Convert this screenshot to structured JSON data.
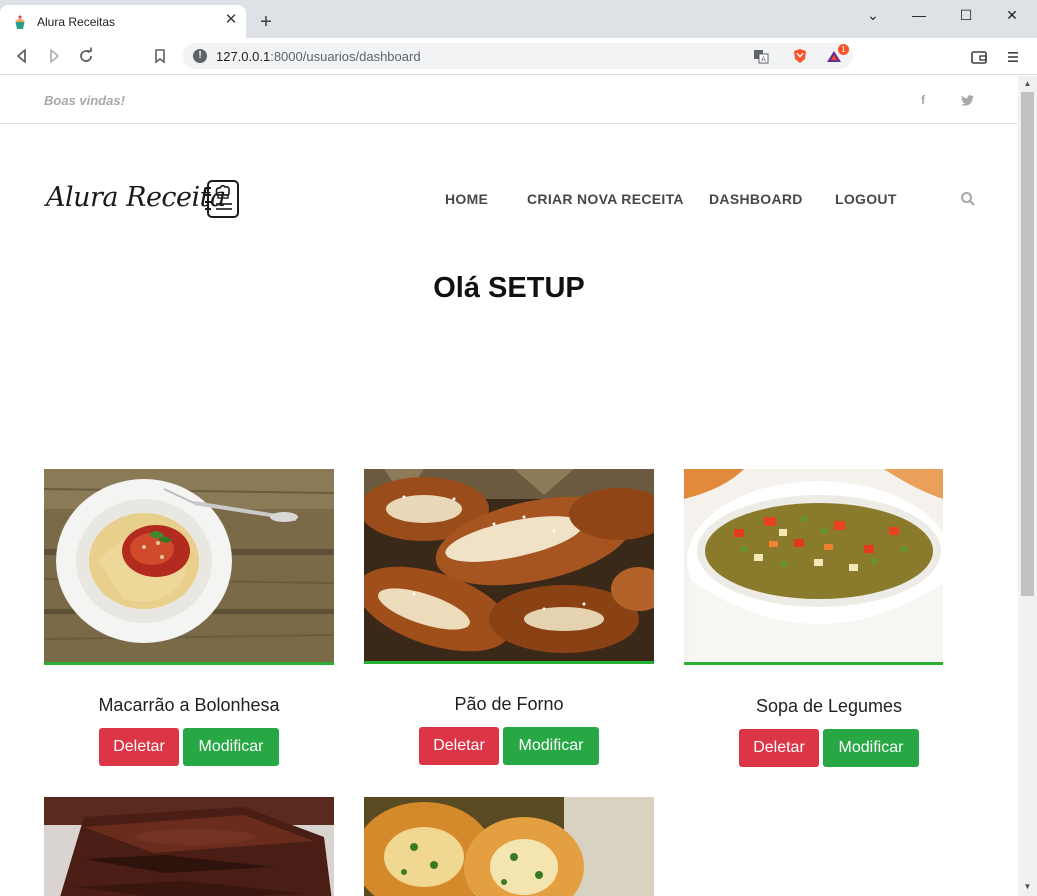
{
  "browser": {
    "tab_title": "Alura Receitas",
    "tab_close": "✕",
    "new_tab": "+",
    "url_host": "127.0.0.1",
    "url_rest": ":8000/usuarios/dashboard",
    "brave_badge": "1",
    "window_controls": {
      "minimize": "—",
      "maximize": "☐",
      "close": "✕",
      "tabsearch": "⌄"
    }
  },
  "topbar": {
    "welcome": "Boas vindas!",
    "facebook": "f",
    "twitter": "t"
  },
  "header": {
    "logo_text": "Alura Receita",
    "nav": [
      "HOME",
      "CRIAR NOVA RECEITA",
      "DASHBOARD",
      "LOGOUT"
    ]
  },
  "main": {
    "greeting": "Olá SETUP"
  },
  "recipes": [
    {
      "title": "Macarrão a Bolonhesa",
      "delete": "Deletar",
      "edit": "Modificar"
    },
    {
      "title": "Pão de Forno",
      "delete": "Deletar",
      "edit": "Modificar"
    },
    {
      "title": "Sopa de Legumes",
      "delete": "Deletar",
      "edit": "Modificar"
    }
  ],
  "colors": {
    "accent_green": "#28b035",
    "delete_red": "#dc3545",
    "modify_green": "#28a745"
  }
}
